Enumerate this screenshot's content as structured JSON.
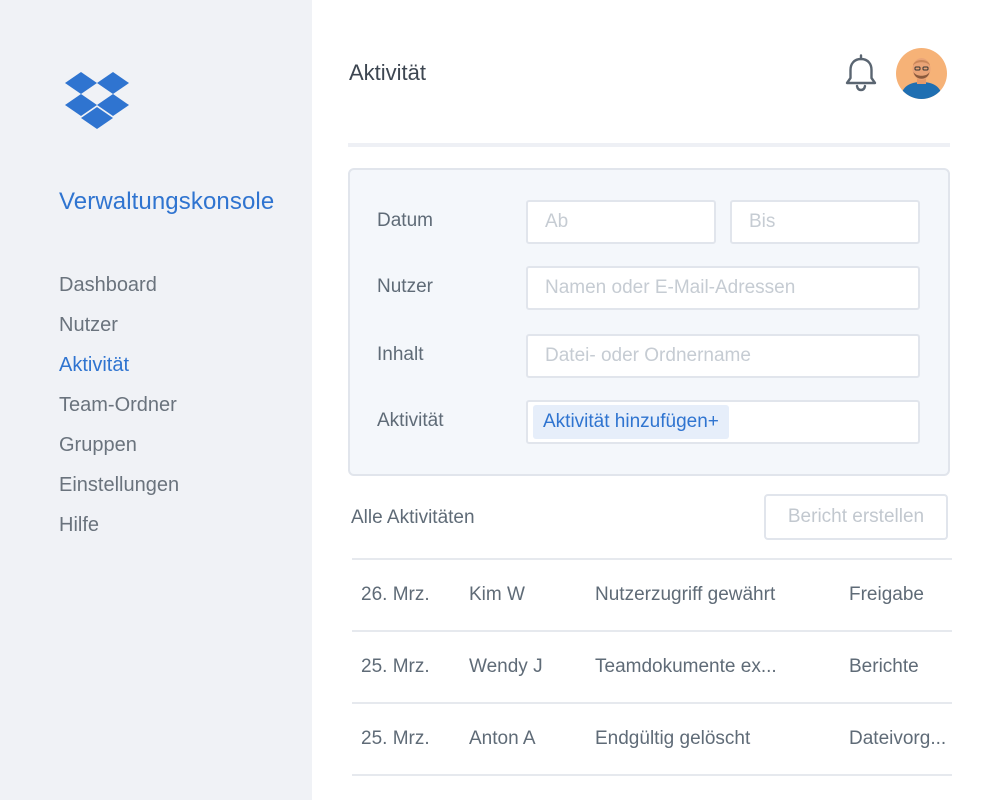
{
  "sidebar": {
    "logo_icon": "dropbox-logo-icon",
    "title": "Verwaltungskonsole",
    "items": [
      {
        "label": "Dashboard",
        "active": false
      },
      {
        "label": "Nutzer",
        "active": false
      },
      {
        "label": "Aktivität",
        "active": true
      },
      {
        "label": "Team-Ordner",
        "active": false
      },
      {
        "label": "Gruppen",
        "active": false
      },
      {
        "label": "Einstellungen",
        "active": false
      },
      {
        "label": "Hilfe",
        "active": false
      }
    ]
  },
  "header": {
    "title": "Aktivität",
    "bell_icon": "bell-icon",
    "avatar_icon": "user-avatar"
  },
  "filters": {
    "date": {
      "label": "Datum",
      "from_placeholder": "Ab",
      "to_placeholder": "Bis"
    },
    "user": {
      "label": "Nutzer",
      "placeholder": "Namen oder E-Mail-Adressen"
    },
    "content": {
      "label": "Inhalt",
      "placeholder": "Datei- oder Ordnername"
    },
    "activity": {
      "label": "Aktivität",
      "chip": "Aktivität hinzufügen+"
    }
  },
  "results": {
    "heading": "Alle Aktivitäten",
    "report_button": "Bericht erstellen",
    "rows": [
      {
        "date": "26. Mrz.",
        "user": "Kim W",
        "action": "Nutzerzugriff gewährt",
        "category": "Freigabe"
      },
      {
        "date": "25. Mrz.",
        "user": "Wendy J",
        "action": "Teamdokumente ex...",
        "category": "Berichte"
      },
      {
        "date": "25. Mrz.",
        "user": "Anton A",
        "action": "Endgültig gelöscht",
        "category": "Dateivorg..."
      }
    ]
  },
  "colors": {
    "accent": "#2f74d0",
    "sidebar_bg": "#f0f2f6",
    "panel_bg": "#f4f7fb",
    "text": "#5f6b77"
  }
}
